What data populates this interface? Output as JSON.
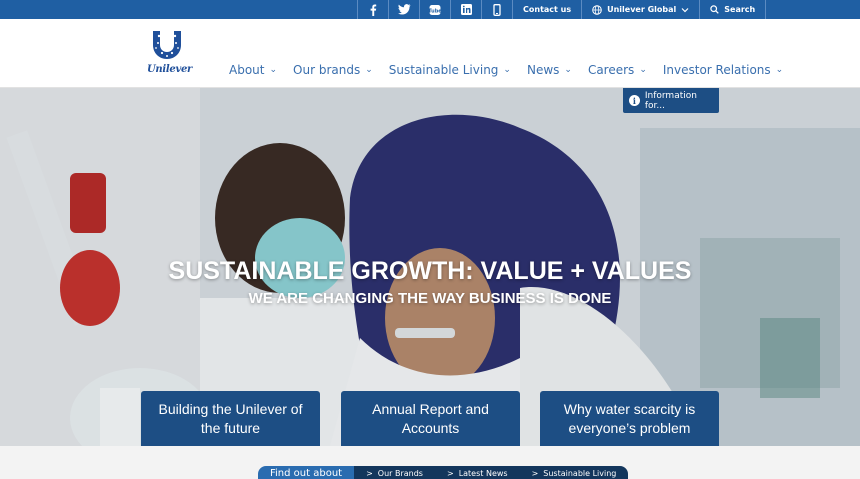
{
  "topbar": {
    "social_icons": [
      "facebook-icon",
      "twitter-icon",
      "youtube-icon",
      "linkedin-icon",
      "mobile-icon"
    ],
    "contact_label": "Contact us",
    "region_label": "Unilever Global",
    "search_label": "Search"
  },
  "header": {
    "logo_text": "Unilever",
    "nav": [
      {
        "label": "About"
      },
      {
        "label": "Our brands"
      },
      {
        "label": "Sustainable Living"
      },
      {
        "label": "News"
      },
      {
        "label": "Careers"
      },
      {
        "label": "Investor Relations"
      }
    ]
  },
  "hero": {
    "info_label": "Information for...",
    "title": "SUSTAINABLE GROWTH: VALUE + VALUES",
    "subtitle": "WE ARE CHANGING THE WAY BUSINESS IS DONE",
    "cards": [
      {
        "label": "Building the Unilever of the future"
      },
      {
        "label": "Annual Report and Accounts"
      },
      {
        "label": "Why water scarcity is everyone’s problem"
      }
    ]
  },
  "find_out": {
    "label": "Find out about",
    "links": [
      {
        "label": "Our Brands"
      },
      {
        "label": "Latest News"
      },
      {
        "label": "Sustainable Living"
      }
    ]
  },
  "colors": {
    "brand_blue": "#1f5fa3",
    "dark_blue": "#1d4e84",
    "nav_text": "#3a6fae"
  }
}
